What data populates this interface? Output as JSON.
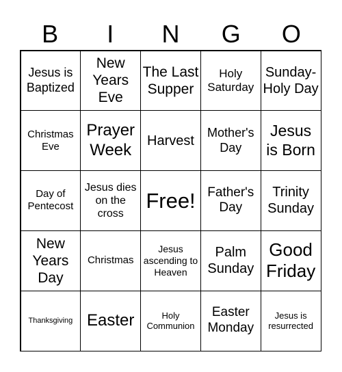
{
  "header": [
    "B",
    "I",
    "N",
    "G",
    "O"
  ],
  "cells": [
    "Jesus is Baptized",
    "New Years Eve",
    "The Last Supper",
    "Holy Saturday",
    "Sunday-Holy Day",
    "Christmas Eve",
    "Prayer Week",
    "Harvest",
    "Mother's Day",
    "Jesus is Born",
    "Day of Pentecost",
    "Jesus dies on the cross",
    "Free!",
    "Father's Day",
    "Trinity Sunday",
    "New Years Day",
    "Christmas",
    "Jesus ascending to Heaven",
    "Palm Sunday",
    "Good Friday",
    "Thanksgiving",
    "Easter",
    "Holy Communion",
    "Easter Monday",
    "Jesus is resurrected"
  ]
}
